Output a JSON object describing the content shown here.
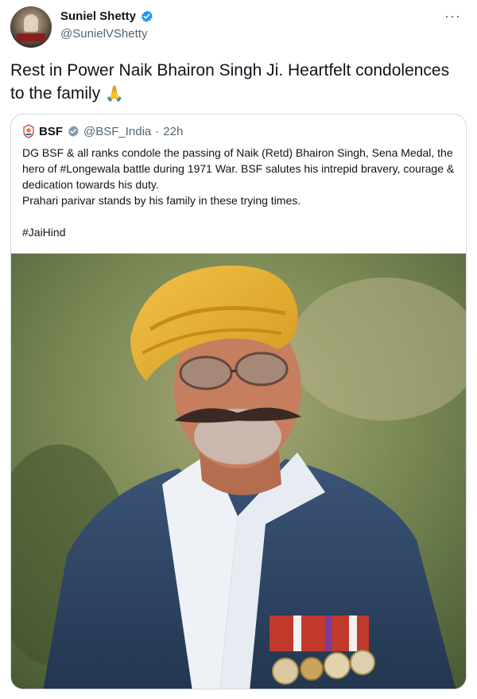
{
  "author": {
    "display_name": "Suniel Shetty",
    "handle": "@SunielVShetty",
    "verified": true,
    "avatar_icon": "avatar-photo"
  },
  "menu_icon": "more-options-icon",
  "tweet_text": "Rest in Power Naik Bhairon Singh Ji. Heartfelt condolences to the family",
  "tweet_emoji": "🙏",
  "quote": {
    "display_name": "BSF",
    "handle": "@BSF_India",
    "separator": "·",
    "time": "22h",
    "paragraphs": [
      "DG BSF & all ranks condole the passing of Naik (Retd) Bhairon Singh, Sena Medal, the hero of #Longewala battle during 1971 War. BSF salutes his intrepid bravery, courage & dedication towards his duty.",
      "Prahari parivar stands by his family in these trying times."
    ],
    "hashtag": "#JaiHind"
  },
  "colors": {
    "verified_blue": "#1d9bf0",
    "secondary_text": "#536471",
    "border": "#cfd9de"
  }
}
